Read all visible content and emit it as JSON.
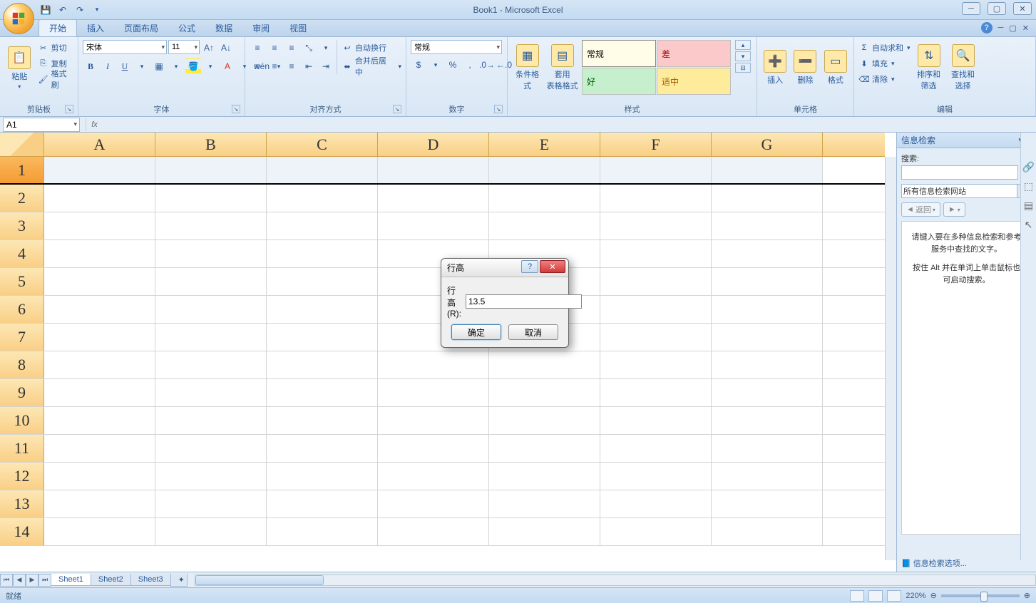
{
  "app": {
    "title": "Book1 - Microsoft Excel"
  },
  "tabs": {
    "t0": "开始",
    "t1": "插入",
    "t2": "页面布局",
    "t3": "公式",
    "t4": "数据",
    "t5": "审阅",
    "t6": "视图"
  },
  "clipboard": {
    "label": "剪贴板",
    "paste": "粘贴",
    "cut": "剪切",
    "copy": "复制",
    "format_painter": "格式刷"
  },
  "font": {
    "label": "字体",
    "name": "宋体",
    "size": "11"
  },
  "align": {
    "label": "对齐方式",
    "wrap": "自动换行",
    "merge": "合并后居中"
  },
  "number": {
    "label": "数字",
    "format": "常规"
  },
  "styles": {
    "label": "样式",
    "cond": "条件格式",
    "table": "套用\n表格格式",
    "normal": "常规",
    "bad": "差",
    "good": "好",
    "neutral": "适中"
  },
  "cells": {
    "label": "单元格",
    "insert": "插入",
    "delete": "删除",
    "format": "格式"
  },
  "editing": {
    "label": "编辑",
    "sum": "自动求和",
    "fill": "填充",
    "clear": "清除",
    "sort": "排序和\n筛选",
    "find": "查找和\n选择"
  },
  "name_box": "A1",
  "columns": [
    "A",
    "B",
    "C",
    "D",
    "E",
    "F",
    "G"
  ],
  "rows": [
    "1",
    "2",
    "3",
    "4",
    "5",
    "6",
    "7",
    "8",
    "9",
    "10",
    "11",
    "12",
    "13",
    "14"
  ],
  "sheets": {
    "s1": "Sheet1",
    "s2": "Sheet2",
    "s3": "Sheet3"
  },
  "status": {
    "ready": "就绪",
    "zoom": "220%"
  },
  "research": {
    "title": "信息检索",
    "search_label": "搜索:",
    "source": "所有信息检索网站",
    "back": "返回",
    "info1": "请键入要在多种信息检索和参考服务中查找的文字。",
    "info2": "按住 Alt 并在单词上单击鼠标也可启动搜索。",
    "options": "信息检索选项..."
  },
  "dialog": {
    "title": "行高",
    "label": "行高(R):",
    "value": "13.5",
    "ok": "确定",
    "cancel": "取消"
  }
}
